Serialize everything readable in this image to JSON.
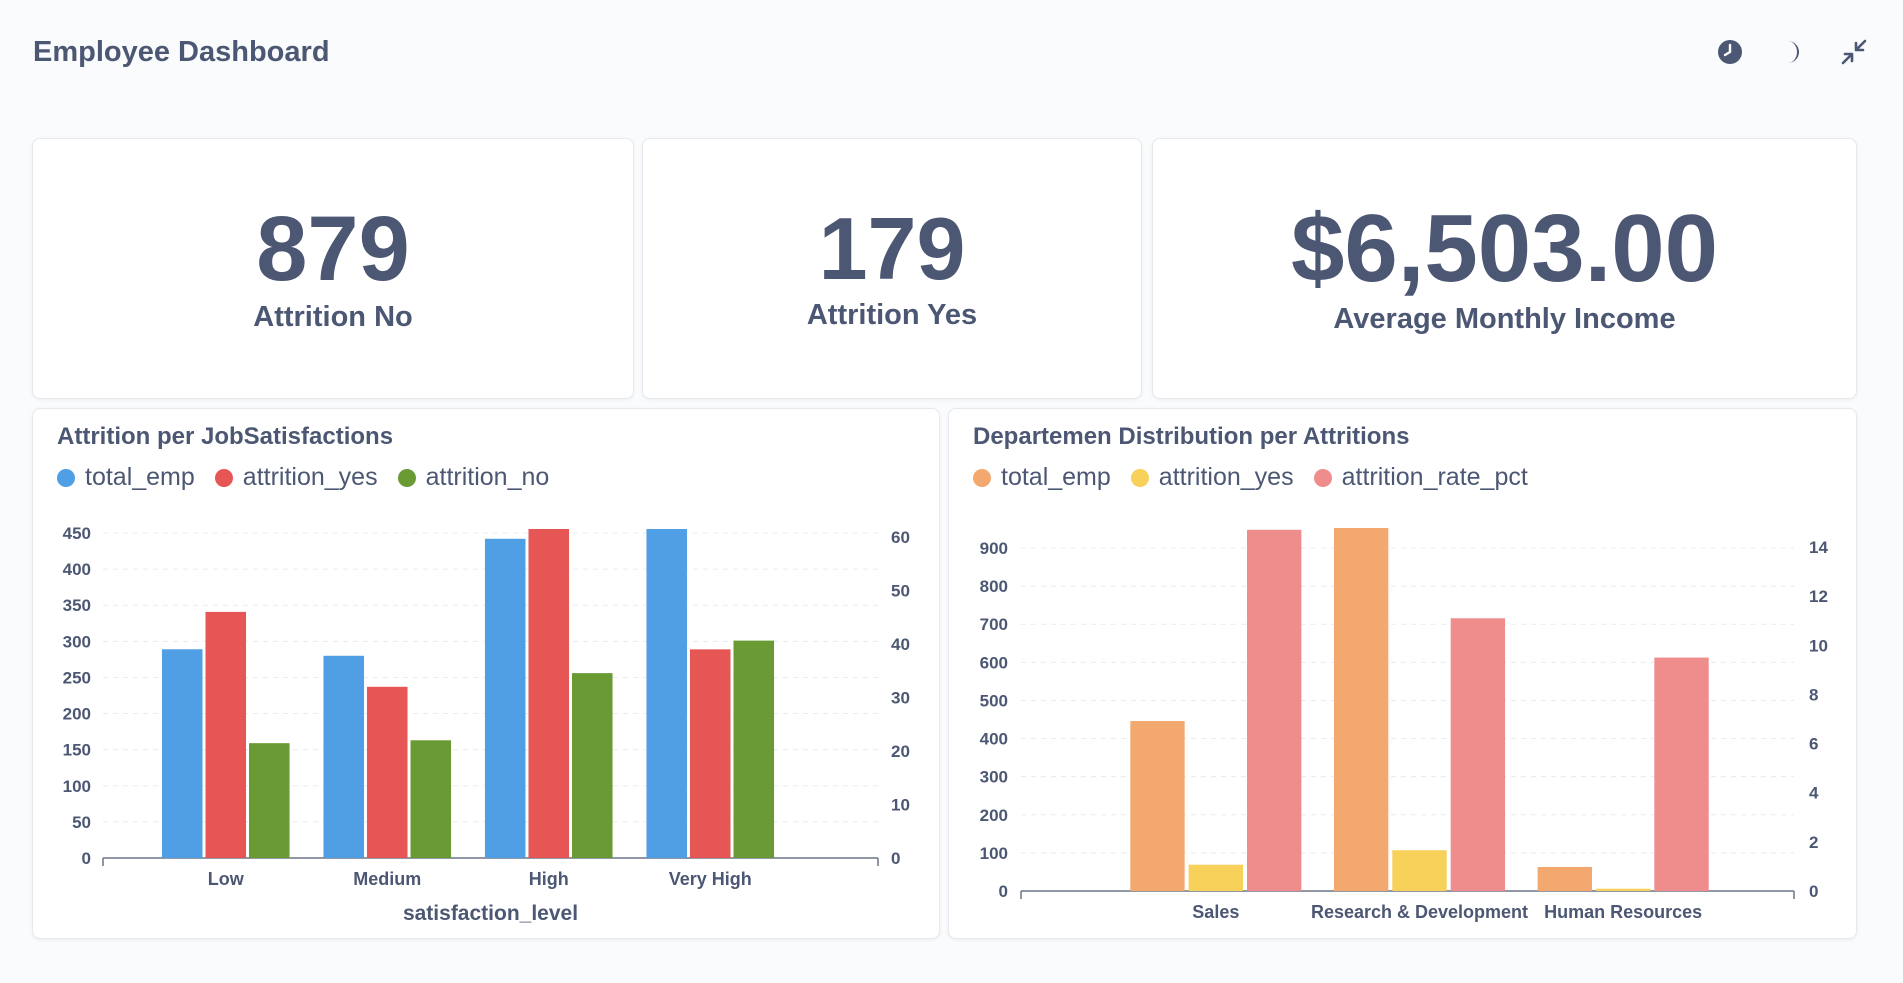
{
  "header": {
    "title": "Employee Dashboard",
    "icons": [
      "clock-icon",
      "moon-icon",
      "collapse-icon"
    ]
  },
  "kpis": [
    {
      "value": "879",
      "label": "Attrition No"
    },
    {
      "value": "179",
      "label": "Attrition Yes"
    },
    {
      "value": "$6,503.00",
      "label": "Average Monthly Income"
    }
  ],
  "colors": {
    "blue": "#509ee3",
    "red": "#e55655",
    "green": "#6a9a34",
    "orange": "#f2a86f",
    "yellow": "#f7d159",
    "pink": "#ef8c8c",
    "text": "#4c5773",
    "grid": "#e8ecf0"
  },
  "chart1": {
    "title": "Attrition per JobSatisfactions",
    "legend": [
      {
        "name": "total_emp",
        "color": "#509ee3"
      },
      {
        "name": "attrition_yes",
        "color": "#e55655"
      },
      {
        "name": "attrition_no",
        "color": "#6a9a34"
      }
    ]
  },
  "chart2": {
    "title": "Departemen Distribution per Attritions",
    "legend": [
      {
        "name": "total_emp",
        "color": "#f2a86f"
      },
      {
        "name": "attrition_yes",
        "color": "#f7d159"
      },
      {
        "name": "attrition_rate_pct",
        "color": "#ef8c8c"
      }
    ]
  },
  "chart_data": [
    {
      "type": "bar",
      "title": "Attrition per JobSatisfactions",
      "categories": [
        "Low",
        "Medium",
        "High",
        "Very High"
      ],
      "xlabel": "satisfaction_level",
      "ylabel": "",
      "left_axis": {
        "ylim": [
          0,
          450
        ],
        "ticks": [
          0,
          50,
          100,
          150,
          200,
          250,
          300,
          350,
          400,
          450
        ]
      },
      "right_axis": {
        "ylim": [
          0,
          60
        ],
        "ticks": [
          0,
          10,
          20,
          30,
          40,
          50,
          60
        ]
      },
      "series": [
        {
          "name": "total_emp",
          "axis": "left",
          "color": "#509ee3",
          "values": [
            289,
            280,
            442,
            459
          ]
        },
        {
          "name": "attrition_yes",
          "axis": "right",
          "color": "#e55655",
          "values": [
            46,
            32,
            62,
            39
          ]
        },
        {
          "name": "attrition_no",
          "axis": "left",
          "color": "#6a9a34",
          "values": [
            159,
            163,
            256,
            301
          ]
        }
      ],
      "grid": true,
      "legend_position": "top-left"
    },
    {
      "type": "bar",
      "title": "Departemen Distribution per Attritions",
      "categories": [
        "Sales",
        "Research & Development",
        "Human Resources"
      ],
      "xlabel": "",
      "ylabel": "",
      "left_axis": {
        "ylim": [
          0,
          900
        ],
        "ticks": [
          0,
          100,
          200,
          300,
          400,
          500,
          600,
          700,
          800,
          900
        ]
      },
      "right_axis": {
        "ylim": [
          0,
          14
        ],
        "ticks": [
          0,
          2,
          4,
          6,
          8,
          10,
          12,
          14
        ]
      },
      "series": [
        {
          "name": "total_emp",
          "axis": "left",
          "color": "#f2a86f",
          "values": [
            446,
            961,
            63
          ]
        },
        {
          "name": "attrition_yes",
          "axis": "left",
          "color": "#f7d159",
          "values": [
            69,
            107,
            6
          ]
        },
        {
          "name": "attrition_rate_pct",
          "axis": "right",
          "color": "#ef8c8c",
          "values": [
            14.7,
            11.1,
            9.5
          ]
        }
      ],
      "grid": true,
      "legend_position": "top-left"
    }
  ]
}
